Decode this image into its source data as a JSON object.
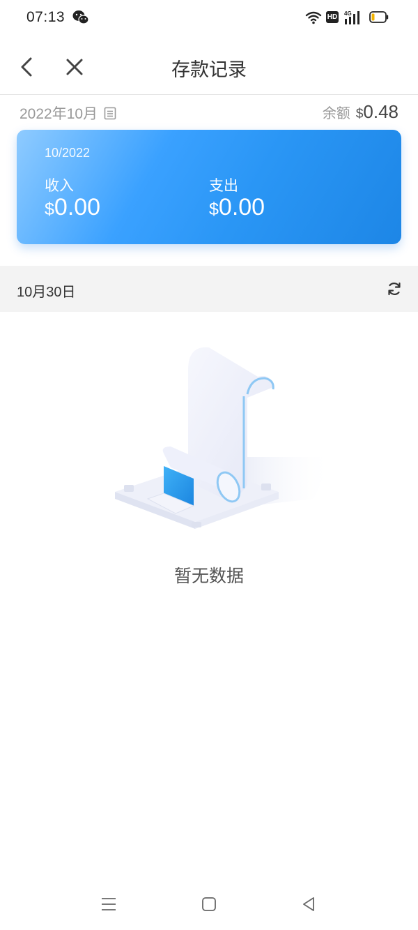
{
  "status_bar": {
    "time": "07:13",
    "hd_badge": "HD",
    "network": "4G"
  },
  "header": {
    "title": "存款记录",
    "back_icon": "chevron-left-icon",
    "close_icon": "close-icon"
  },
  "summary": {
    "month": "2022年10月",
    "balance_label": "余额",
    "balance_currency": "$",
    "balance_amount": "0.48"
  },
  "card": {
    "month": "10/2022",
    "income_label": "收入",
    "income_currency": "$",
    "income_amount": "0.00",
    "expense_label": "支出",
    "expense_currency": "$",
    "expense_amount": "0.00",
    "gradient_start": "#8fcbff",
    "gradient_end": "#1d86e6"
  },
  "date_section": {
    "date": "10月30日",
    "refresh_icon": "refresh-icon"
  },
  "empty_state": {
    "text": "暂无数据",
    "illustration": "receipt-scroll-illustration"
  },
  "nav_bar": {
    "menu_icon": "menu-icon",
    "home_icon": "square-icon",
    "back_icon": "triangle-back-icon"
  }
}
